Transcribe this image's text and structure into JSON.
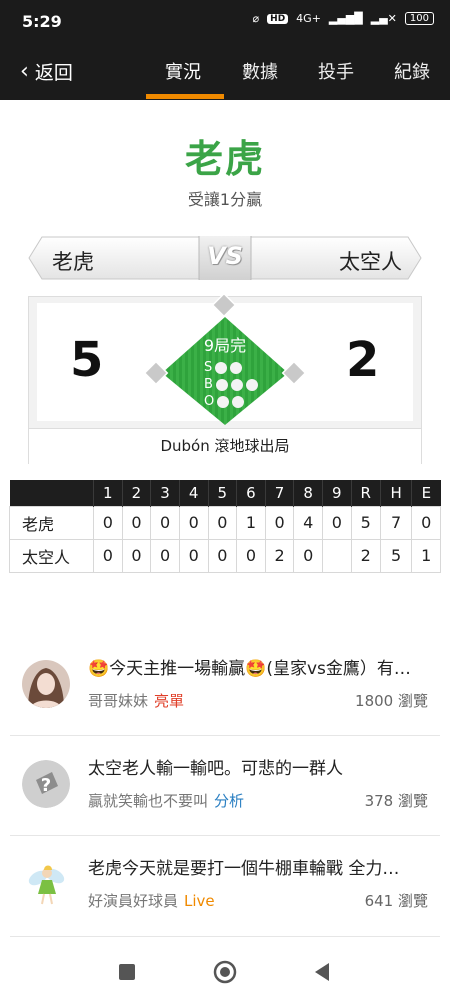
{
  "status": {
    "time": "5:29",
    "network": "4G+",
    "battery": "100"
  },
  "nav": {
    "back_label": "返回",
    "tabs": [
      "實況",
      "數據",
      "投手",
      "紀錄"
    ],
    "active_tab": 0
  },
  "game": {
    "winner": "老虎",
    "result_text": "受讓1分贏",
    "away_team": "老虎",
    "home_team": "太空人",
    "vs_label": "VS",
    "away_score": "5",
    "home_score": "2",
    "inning": "9局完",
    "count_labels": [
      "S",
      "B",
      "O"
    ],
    "last_play": "Dubón 滾地球出局"
  },
  "linescore": {
    "headers": [
      "1",
      "2",
      "3",
      "4",
      "5",
      "6",
      "7",
      "8",
      "9",
      "R",
      "H",
      "E"
    ],
    "rows": [
      {
        "team": "老虎",
        "cells": [
          "0",
          "0",
          "0",
          "0",
          "0",
          "1",
          "0",
          "4",
          "0",
          "5",
          "7",
          "0"
        ]
      },
      {
        "team": "太空人",
        "cells": [
          "0",
          "0",
          "0",
          "0",
          "0",
          "0",
          "2",
          "0",
          "",
          "2",
          "5",
          "1"
        ]
      }
    ]
  },
  "posts": [
    {
      "title": "🤩今天主推一場輸贏🤩(皇家vs金鷹）有…",
      "author": "哥哥妹妹",
      "tag": "亮單",
      "tag_color": "#e0402a",
      "views": "1800 瀏覽",
      "avatar": "photo-avatar"
    },
    {
      "title": "太空老人輸一輸吧。可悲的一群人",
      "author": "贏就笑輸也不要叫",
      "tag": "分析",
      "tag_color": "#2a7fc2",
      "views": "378 瀏覽",
      "avatar": "question-mark-icon"
    },
    {
      "title": "老虎今天就是要打一個牛棚車輪戰 全力…",
      "author": "好演員好球員",
      "tag": "Live",
      "tag_color": "#f08a00",
      "views": "641 瀏覽",
      "avatar": "fairy-icon"
    }
  ],
  "colors": {
    "accent": "#f08a00",
    "winner_green": "#3ba447",
    "field_green": "#2fa33c"
  }
}
